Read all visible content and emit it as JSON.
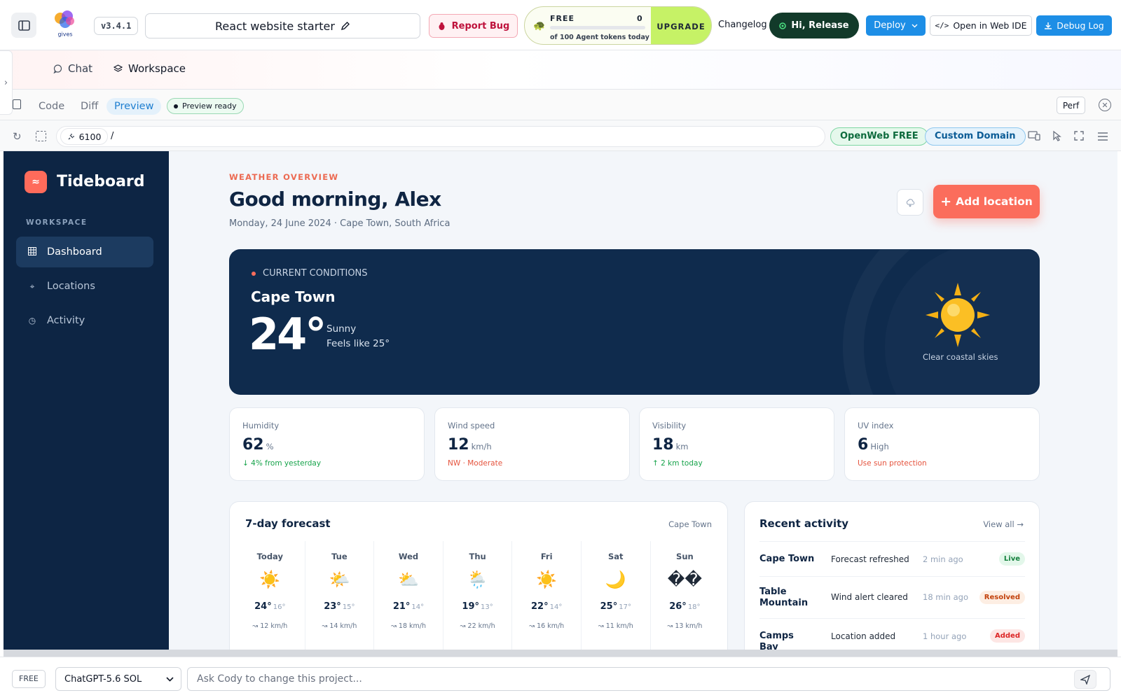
{
  "topbar": {
    "version": "v3.4.1",
    "project_name": "React website starter",
    "report_bug": "Report Bug",
    "tokens": {
      "plan": "FREE",
      "used": "0",
      "used_fraction": 0,
      "subtitle": "of 100 Agent tokens today",
      "upgrade": "UPGRADE"
    },
    "changelog": "Changelog",
    "greeting_button": "Hi, Release",
    "deploy": "Deploy",
    "open_ide": "Open in Web IDE",
    "debug_log": "Debug Log"
  },
  "workspace_tabs": {
    "chat": "Chat",
    "workspace": "Workspace"
  },
  "editor": {
    "tabs": [
      "Code",
      "Diff",
      "Preview"
    ],
    "active_tab": "Preview",
    "status": "Preview ready",
    "perf": "Perf"
  },
  "address": {
    "port": "6100",
    "path": "/",
    "badge_openweb": "OpenWeb FREE",
    "badge_domain": "Custom Domain"
  },
  "app": {
    "brand": "Tideboard",
    "brand_mark": "≈",
    "section_label": "WORKSPACE",
    "nav": [
      {
        "label": "Dashboard",
        "icon": "grid-icon",
        "active": true
      },
      {
        "label": "Locations",
        "icon": "pin-icon",
        "active": false
      },
      {
        "label": "Activity",
        "icon": "clock-icon",
        "active": false
      }
    ],
    "eyebrow": "WEATHER OVERVIEW",
    "greeting": "Good morning, Alex",
    "dateline": "Monday, 24 June 2024 · Cape Town, South Africa",
    "add_location": "Add location",
    "current": {
      "label": "CURRENT CONDITIONS",
      "city": "Cape Town",
      "temp": "24°",
      "condition": "Sunny",
      "feels_like": "Feels like 25°",
      "caption": "Clear coastal skies"
    },
    "stats": [
      {
        "label": "Humidity",
        "value": "62",
        "unit": "%",
        "note": "↓ 4% from yesterday",
        "tone": "green"
      },
      {
        "label": "Wind speed",
        "value": "12",
        "unit": "km/h",
        "note": "NW · Moderate",
        "tone": "red"
      },
      {
        "label": "Visibility",
        "value": "18",
        "unit": "km",
        "note": "↑ 2 km today",
        "tone": "green"
      },
      {
        "label": "UV index",
        "value": "6",
        "unit": "High",
        "note": "Use sun protection",
        "tone": "red"
      }
    ],
    "forecast": {
      "title": "7-day forecast",
      "location": "Cape Town",
      "days": [
        {
          "day": "Today",
          "icon": "☀️",
          "hi": "24°",
          "lo": "16°",
          "wind": "↝ 12 km/h"
        },
        {
          "day": "Tue",
          "icon": "🌤️",
          "hi": "23°",
          "lo": "15°",
          "wind": "↝ 14 km/h"
        },
        {
          "day": "Wed",
          "icon": "⛅",
          "hi": "21°",
          "lo": "14°",
          "wind": "↝ 18 km/h"
        },
        {
          "day": "Thu",
          "icon": "🌦️",
          "hi": "19°",
          "lo": "13°",
          "wind": "↝ 22 km/h"
        },
        {
          "day": "Fri",
          "icon": "☀️",
          "hi": "22°",
          "lo": "14°",
          "wind": "↝ 16 km/h"
        },
        {
          "day": "Sat",
          "icon": "🌙",
          "hi": "25°",
          "lo": "17°",
          "wind": "↝ 11 km/h"
        },
        {
          "day": "Sun",
          "icon": "��",
          "hi": "26°",
          "lo": "18°",
          "wind": "↝ 13 km/h"
        }
      ]
    },
    "activity": {
      "title": "Recent activity",
      "view_all": "View all →",
      "rows": [
        {
          "location": "Cape Town",
          "event": "Forecast refreshed",
          "time": "2 min ago",
          "status": "Live",
          "tone": "live"
        },
        {
          "location": "Table Mountain",
          "event": "Wind alert cleared",
          "time": "18 min ago",
          "status": "Resolved",
          "tone": "resolved"
        },
        {
          "location": "Camps Bay",
          "event": "Location added",
          "time": "1 hour ago",
          "status": "Added",
          "tone": "added"
        }
      ]
    }
  },
  "bottom": {
    "plan": "FREE",
    "model": "ChatGPT-5.6 SOL",
    "prompt_placeholder": "Ask Cody to change this project..."
  }
}
